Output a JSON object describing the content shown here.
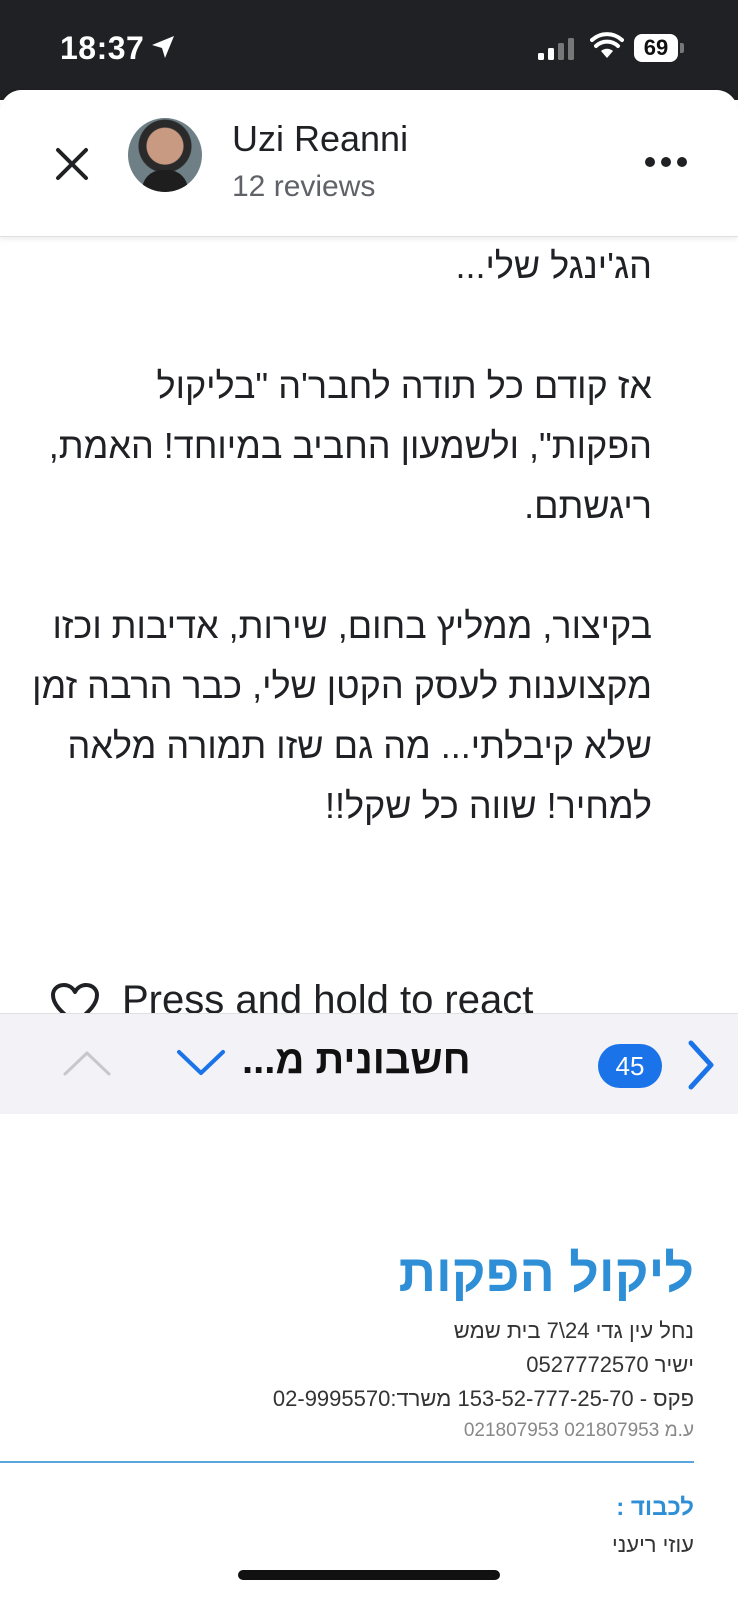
{
  "status_bar": {
    "time": "18:37",
    "battery": "69"
  },
  "header": {
    "reviewer_name": "Uzi Reanni",
    "reviewer_count": "12 reviews"
  },
  "review": {
    "paragraphs": [
      "הג'ינגל שלי...",
      "אז קודם כל תודה לחבר'ה \"בליקול הפקות\", ולשמעון החביב במיוחד! האמת, ריגשתם.",
      "בקיצור, ממליץ בחום, שירות, אדיבות וכזו מקצוענות לעסק הקטן שלי, כבר הרבה זמן שלא קיבלתי... מה גם שזו תמורה מלאה למחיר! שווה כל שקל!!"
    ]
  },
  "react": {
    "label": "Press and hold to react"
  },
  "email_bar": {
    "subject": "חשבונית מ...",
    "count": "45"
  },
  "document": {
    "company_name": "ליקול הפקות",
    "address": "נחל עין גדי 24\\7 בית שמש",
    "direct_phone": "ישיר 0527772570",
    "fax_office": "פקס - 153-52-777-25-70 משרד:02-9995570",
    "registration": "ע.מ 021807953 021807953",
    "to_label": "לכבוד :",
    "to_name": "עוזי ריעני"
  },
  "colors": {
    "accent": "#1a73e8",
    "doc_blue": "#2f8fd6",
    "status_bar": "#202124"
  },
  "icons": {
    "close": "close-icon",
    "more": "more-vert-icon",
    "heart": "heart-outline-icon",
    "up": "chevron-up-icon",
    "down": "chevron-down-icon",
    "next": "chevron-right-icon"
  }
}
